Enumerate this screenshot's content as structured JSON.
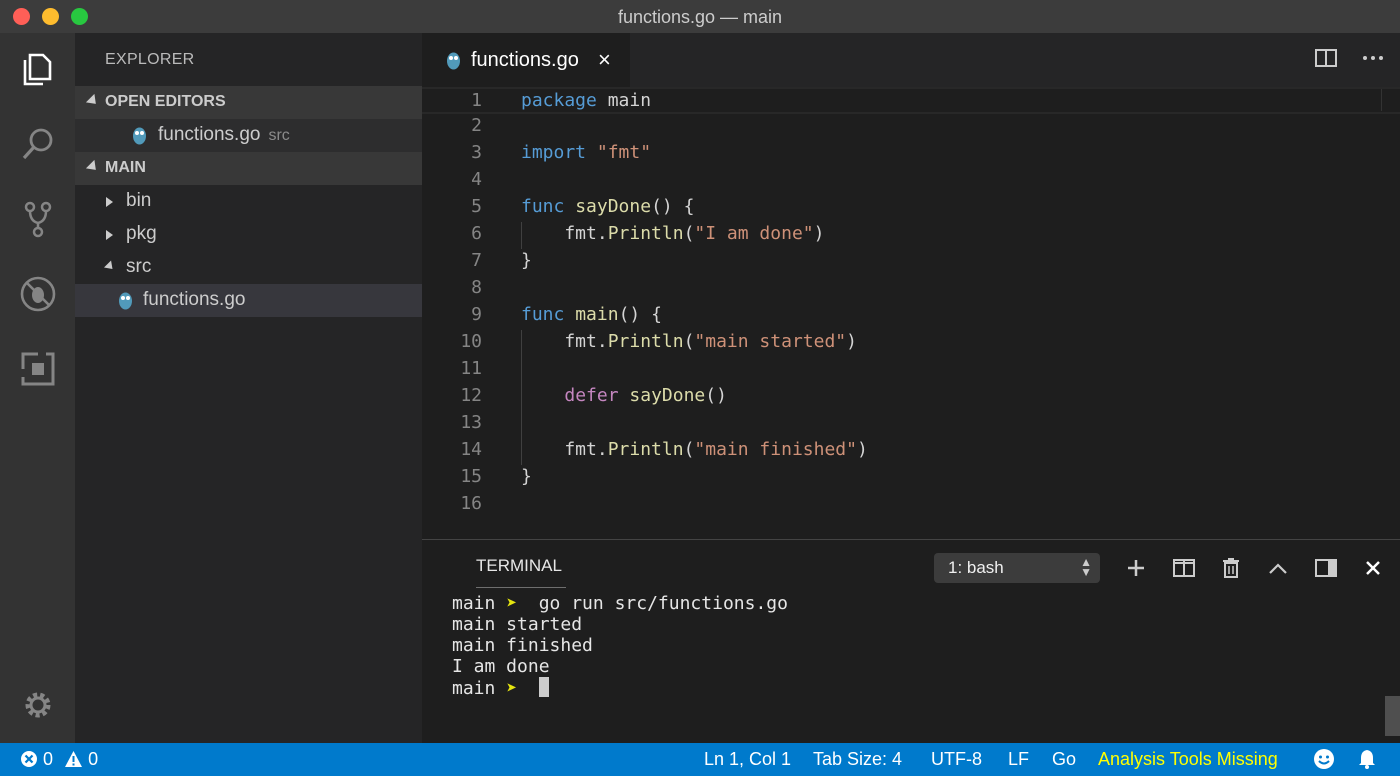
{
  "window": {
    "title": "functions.go — main"
  },
  "activity_bar": {
    "items": [
      "explorer",
      "search",
      "source-control",
      "debug",
      "extensions"
    ],
    "bottom": "settings"
  },
  "sidebar": {
    "title": "EXPLORER",
    "open_editors": {
      "header": "OPEN EDITORS",
      "files": [
        {
          "name": "functions.go",
          "folder": "src"
        }
      ]
    },
    "folder": {
      "header": "MAIN",
      "items": [
        {
          "name": "bin",
          "type": "folder",
          "expanded": false
        },
        {
          "name": "pkg",
          "type": "folder",
          "expanded": false
        },
        {
          "name": "src",
          "type": "folder",
          "expanded": true
        },
        {
          "name": "functions.go",
          "type": "file",
          "selected": true
        }
      ]
    }
  },
  "editor": {
    "tab": {
      "label": "functions.go",
      "close": "×"
    },
    "lines": [
      [
        {
          "t": "package",
          "c": "kw"
        },
        {
          "t": " main"
        }
      ],
      [],
      [
        {
          "t": "import",
          "c": "kw"
        },
        {
          "t": " "
        },
        {
          "t": "\"fmt\"",
          "c": "str"
        }
      ],
      [],
      [
        {
          "t": "func",
          "c": "kw"
        },
        {
          "t": " "
        },
        {
          "t": "sayDone",
          "c": "fn"
        },
        {
          "t": "() {"
        }
      ],
      [
        {
          "t": "    fmt."
        },
        {
          "t": "Println",
          "c": "fn"
        },
        {
          "t": "("
        },
        {
          "t": "\"I am done\"",
          "c": "str"
        },
        {
          "t": ")"
        }
      ],
      [
        {
          "t": "}"
        }
      ],
      [],
      [
        {
          "t": "func",
          "c": "kw"
        },
        {
          "t": " "
        },
        {
          "t": "main",
          "c": "fn"
        },
        {
          "t": "() {"
        }
      ],
      [
        {
          "t": "    fmt."
        },
        {
          "t": "Println",
          "c": "fn"
        },
        {
          "t": "("
        },
        {
          "t": "\"main started\"",
          "c": "str"
        },
        {
          "t": ")"
        }
      ],
      [],
      [
        {
          "t": "    "
        },
        {
          "t": "defer",
          "c": "kw2"
        },
        {
          "t": " "
        },
        {
          "t": "sayDone",
          "c": "fn"
        },
        {
          "t": "()"
        }
      ],
      [],
      [
        {
          "t": "    fmt."
        },
        {
          "t": "Println",
          "c": "fn"
        },
        {
          "t": "("
        },
        {
          "t": "\"main finished\"",
          "c": "str"
        },
        {
          "t": ")"
        }
      ],
      [
        {
          "t": "}"
        }
      ],
      []
    ]
  },
  "panel": {
    "title": "TERMINAL",
    "terminal_select": "1: bash",
    "output": [
      {
        "prompt": "main",
        "arrow": "➤",
        "text": " go run src/functions.go"
      },
      {
        "text": "main started"
      },
      {
        "text": "main finished"
      },
      {
        "text": "I am done"
      },
      {
        "prompt": "main",
        "arrow": "➤",
        "text": " ",
        "cursor": true
      }
    ]
  },
  "statusbar": {
    "errors": "0",
    "warnings": "0",
    "position": "Ln 1, Col 1",
    "tab_size": "Tab Size: 4",
    "encoding": "UTF-8",
    "eol": "LF",
    "language": "Go",
    "analysis": "Analysis Tools Missing"
  },
  "colors": {
    "statusbar": "#007acc",
    "keyword": "#569cd6",
    "string": "#ce9178",
    "function": "#dcdcaa",
    "warning": "#ffff00"
  }
}
